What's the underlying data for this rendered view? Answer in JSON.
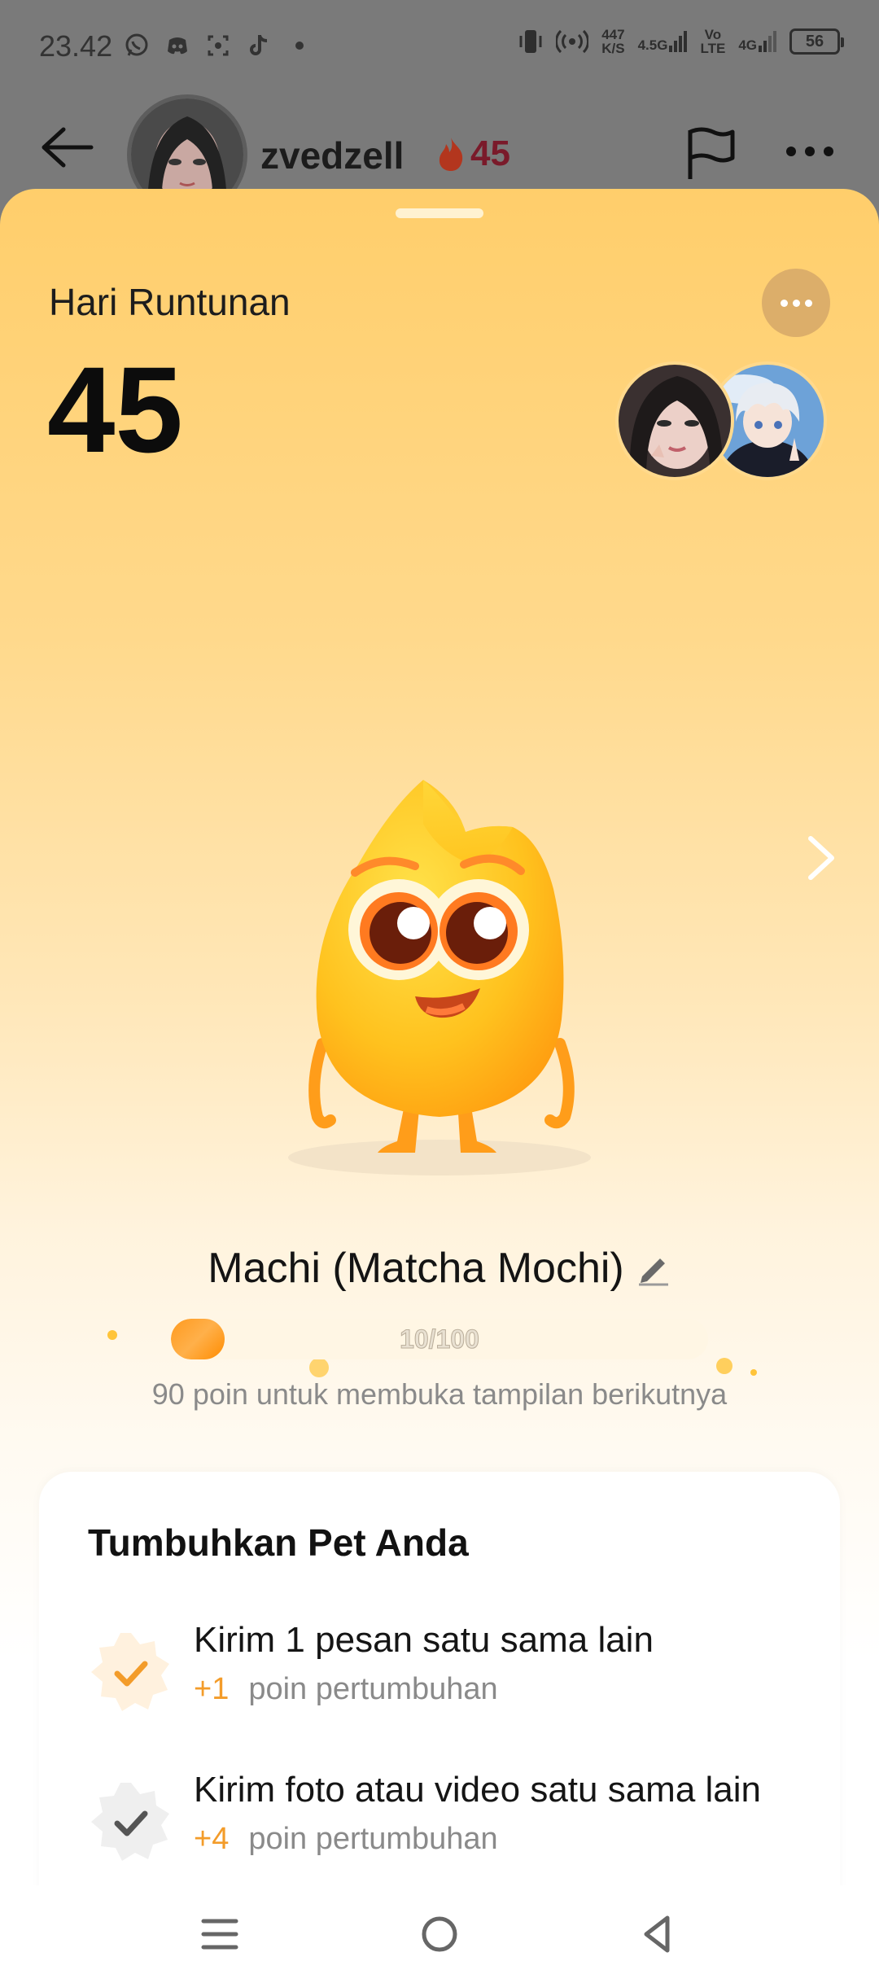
{
  "status_bar": {
    "time": "23.42",
    "net_speed_top": "447",
    "net_speed_bottom": "K/S",
    "network_1_top": "4.5G",
    "volte_top": "Vo",
    "volte_bottom": "LTE",
    "network_2_top": "4G",
    "battery": "56"
  },
  "chat_header": {
    "username": "zvedzell",
    "streak": "45"
  },
  "sheet": {
    "title": "Hari Runtunan",
    "streak_days": "45",
    "pet_name": "Machi (Matcha Mochi)",
    "progress_text": "10/100",
    "progress_fraction": 0.1,
    "progress_hint": "90 poin untuk membuka tampilan berikutnya"
  },
  "grow_card": {
    "title": "Tumbuhkan Pet Anda",
    "tasks": [
      {
        "title": "Kirim 1 pesan satu sama lain",
        "plus": "+1",
        "points_label": "poin pertumbuhan",
        "done": true
      },
      {
        "title": "Kirim foto atau video satu sama lain",
        "plus": "+4",
        "points_label": "poin pertumbuhan",
        "done": false
      }
    ]
  },
  "colors": {
    "sheet_top": "#ffce6b",
    "accent_orange": "#f39c2a",
    "flame": "#ff5a2a"
  },
  "icons": [
    "whatsapp-icon",
    "discord-icon",
    "screenshot-icon",
    "tiktok-icon",
    "vibrate-icon",
    "hotspot-icon",
    "back-arrow-icon",
    "flame-icon",
    "flag-icon",
    "more-icon",
    "chevron-right-icon",
    "edit-icon",
    "check-icon",
    "menu-nav-icon",
    "home-nav-icon",
    "back-nav-icon"
  ]
}
